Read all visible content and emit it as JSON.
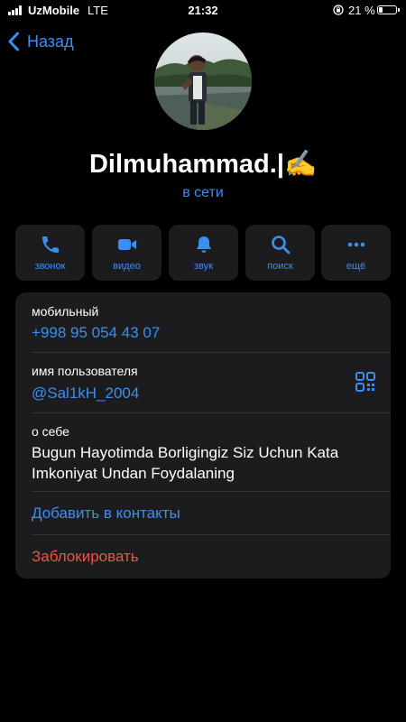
{
  "status_bar": {
    "carrier": "UzMobile",
    "network": "LTE",
    "time": "21:32",
    "battery": "21 %",
    "battery_level": 0.21
  },
  "nav": {
    "back_label": "Назад"
  },
  "profile": {
    "name": "Dilmuhammad.|✍️",
    "status": "в сети"
  },
  "actions": [
    {
      "label": "звонок",
      "icon": "phone-icon"
    },
    {
      "label": "видео",
      "icon": "video-camera-icon"
    },
    {
      "label": "звук",
      "icon": "bell-icon"
    },
    {
      "label": "поиск",
      "icon": "search-icon"
    },
    {
      "label": "ещё",
      "icon": "more-icon"
    }
  ],
  "info": {
    "mobile_label": "мобильный",
    "mobile_value": "+998 95 054 43 07",
    "username_label": "имя пользователя",
    "username_value": "@Sal1kH_2004",
    "about_label": "о себе",
    "about_value": "Bugun Hayotimda Borligingiz Siz Uchun Kata Imkoniyat Undan Foydalaning",
    "add_contact": "Добавить в контакты",
    "block": "Заблокировать"
  },
  "colors": {
    "accent": "#3b8ff0",
    "danger": "#eb5545",
    "card": "#1c1c1e",
    "background": "#000000"
  }
}
